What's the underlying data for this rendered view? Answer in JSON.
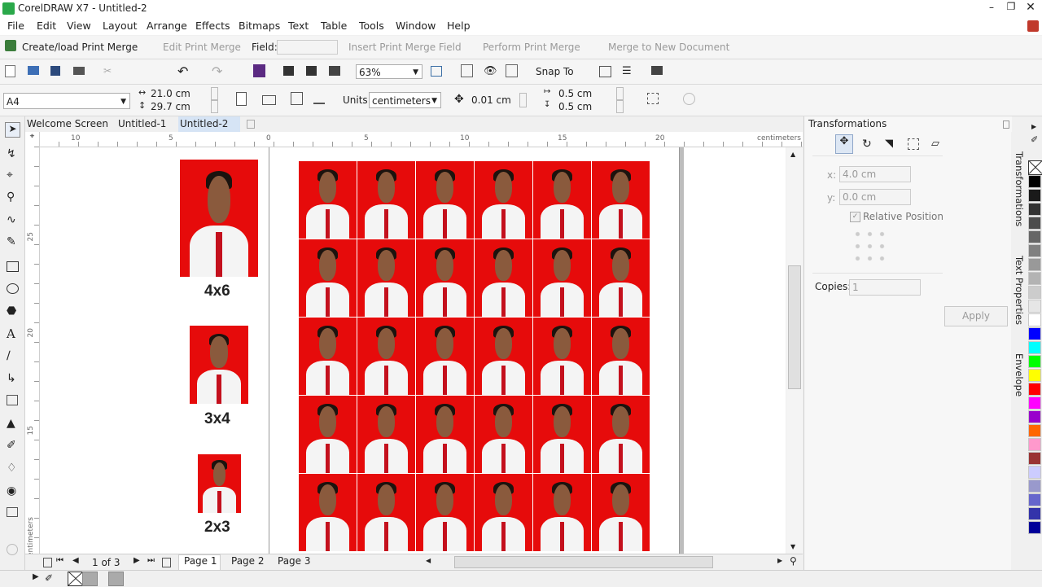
{
  "window": {
    "title": "CorelDRAW X7 - Untitled-2"
  },
  "menu": [
    "File",
    "Edit",
    "View",
    "Layout",
    "Arrange",
    "Effects",
    "Bitmaps",
    "Text",
    "Table",
    "Tools",
    "Window",
    "Help"
  ],
  "merge_bar": {
    "create": "Create/load Print Merge",
    "edit": "Edit Print Merge",
    "field_label": "Field:",
    "insert": "Insert Print Merge Field",
    "perform": "Perform Print Merge",
    "merge_new": "Merge to New Document"
  },
  "standard_bar": {
    "zoom": "63%",
    "snap": "Snap To"
  },
  "property_bar": {
    "page_size": "A4",
    "width": "21.0 cm",
    "height": "29.7 cm",
    "units_label": "Units:",
    "units": "centimeters",
    "nudge": "0.01 cm",
    "dup_x": "0.5 cm",
    "dup_y": "0.5 cm"
  },
  "doc_tabs": [
    "Welcome Screen",
    "Untitled-1",
    "Untitled-2"
  ],
  "ruler": {
    "units": "centimeters",
    "h_labels": [
      "10",
      "5",
      "0",
      "5",
      "10",
      "15",
      "20"
    ],
    "v_labels": [
      "25",
      "20",
      "15"
    ],
    "v_units": "centimeters"
  },
  "canvas": {
    "labels": [
      "4x6",
      "3x4",
      "2x3"
    ]
  },
  "pager": {
    "count": "1 of 3",
    "pages": [
      "Page 1",
      "Page 2",
      "Page 3"
    ]
  },
  "docker": {
    "title": "Transformations",
    "x_label": "x:",
    "x_value": "4.0 cm",
    "y_label": "y:",
    "y_value": "0.0 cm",
    "relative": "Relative Position",
    "copies_label": "Copies:",
    "copies_value": "1",
    "apply": "Apply",
    "side_tabs": [
      "Transformations",
      "Text Properties",
      "Envelope"
    ]
  },
  "palette_colors": [
    "#000000",
    "#1a1a1a",
    "#333333",
    "#4d4d4d",
    "#666666",
    "#808080",
    "#999999",
    "#b3b3b3",
    "#cccccc",
    "#e6e6e6",
    "#ffffff",
    "#0000ff",
    "#00ffff",
    "#00ff00",
    "#ffff00",
    "#ff0000",
    "#ff00ff",
    "#9900cc",
    "#ff6600",
    "#ff99cc",
    "#993333",
    "#ccccff",
    "#9999cc",
    "#6666cc",
    "#3333aa",
    "#000099"
  ]
}
